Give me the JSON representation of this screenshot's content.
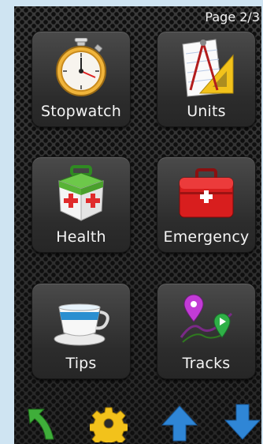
{
  "status": {
    "page_indicator": "Page 2/3"
  },
  "tiles": [
    {
      "label": "Stopwatch",
      "icon": "stopwatch-icon"
    },
    {
      "label": "Units",
      "icon": "drafting-tools-icon"
    },
    {
      "label": "Health",
      "icon": "first-aid-kit-icon"
    },
    {
      "label": "Emergency",
      "icon": "emergency-case-icon"
    },
    {
      "label": "Tips",
      "icon": "tea-cup-icon"
    },
    {
      "label": "Tracks",
      "icon": "map-track-icon"
    }
  ],
  "bottom_bar": {
    "buttons": [
      "back-arrow-icon",
      "gear-icon",
      "arrow-up-icon",
      "arrow-down-icon"
    ]
  },
  "colors": {
    "background": "#cfe4f2",
    "tile": "#3a3a3a",
    "label_text": "#f4f4f4",
    "back_arrow": "#3fae3a",
    "gear": "#f2c21b",
    "nav_arrows": "#2f86d6"
  }
}
